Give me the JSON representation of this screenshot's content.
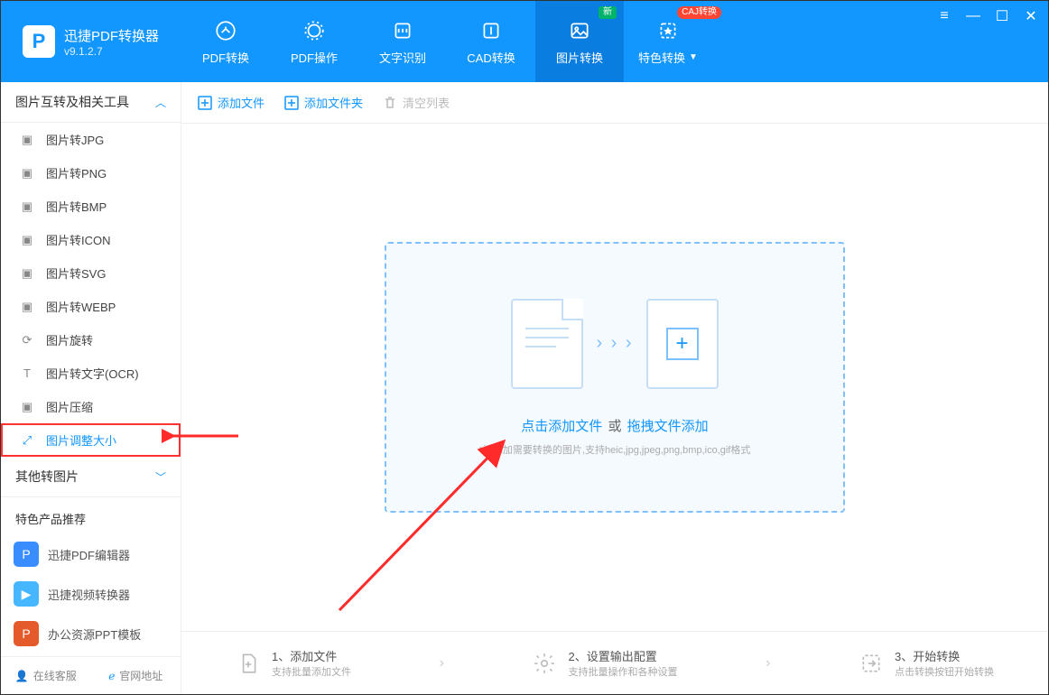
{
  "app": {
    "title": "迅捷PDF转换器",
    "version": "v9.1.2.7"
  },
  "nav": [
    {
      "label": "PDF转换"
    },
    {
      "label": "PDF操作"
    },
    {
      "label": "文字识别"
    },
    {
      "label": "CAD转换"
    },
    {
      "label": "图片转换",
      "badge_new": "新"
    },
    {
      "label": "特色转换",
      "dropdown": true,
      "badge_caj": "CAJ转换"
    }
  ],
  "sidebar": {
    "section1": {
      "title": "图片互转及相关工具"
    },
    "items": [
      {
        "label": "图片转JPG"
      },
      {
        "label": "图片转PNG"
      },
      {
        "label": "图片转BMP"
      },
      {
        "label": "图片转ICON"
      },
      {
        "label": "图片转SVG"
      },
      {
        "label": "图片转WEBP"
      },
      {
        "label": "图片旋转"
      },
      {
        "label": "图片转文字(OCR)"
      },
      {
        "label": "图片压缩"
      },
      {
        "label": "图片调整大小"
      }
    ],
    "section2": {
      "title": "其他转图片"
    },
    "promo": {
      "title": "特色产品推荐",
      "items": [
        {
          "label": "迅捷PDF编辑器"
        },
        {
          "label": "迅捷视频转换器"
        },
        {
          "label": "办公资源PPT模板"
        }
      ]
    },
    "footer": {
      "support": "在线客服",
      "site": "官网地址"
    }
  },
  "toolbar": {
    "add_file": "添加文件",
    "add_folder": "添加文件夹",
    "clear": "清空列表"
  },
  "drop": {
    "click_link": "点击添加文件",
    "sep": "或",
    "drag_link": "拖拽文件添加",
    "hint": "*请添加需要转换的图片,支持heic,jpg,jpeg,png,bmp,ico,gif格式"
  },
  "steps": [
    {
      "title": "1、添加文件",
      "desc": "支持批量添加文件"
    },
    {
      "title": "2、设置输出配置",
      "desc": "支持批量操作和各种设置"
    },
    {
      "title": "3、开始转换",
      "desc": "点击转换按钮开始转换"
    }
  ]
}
